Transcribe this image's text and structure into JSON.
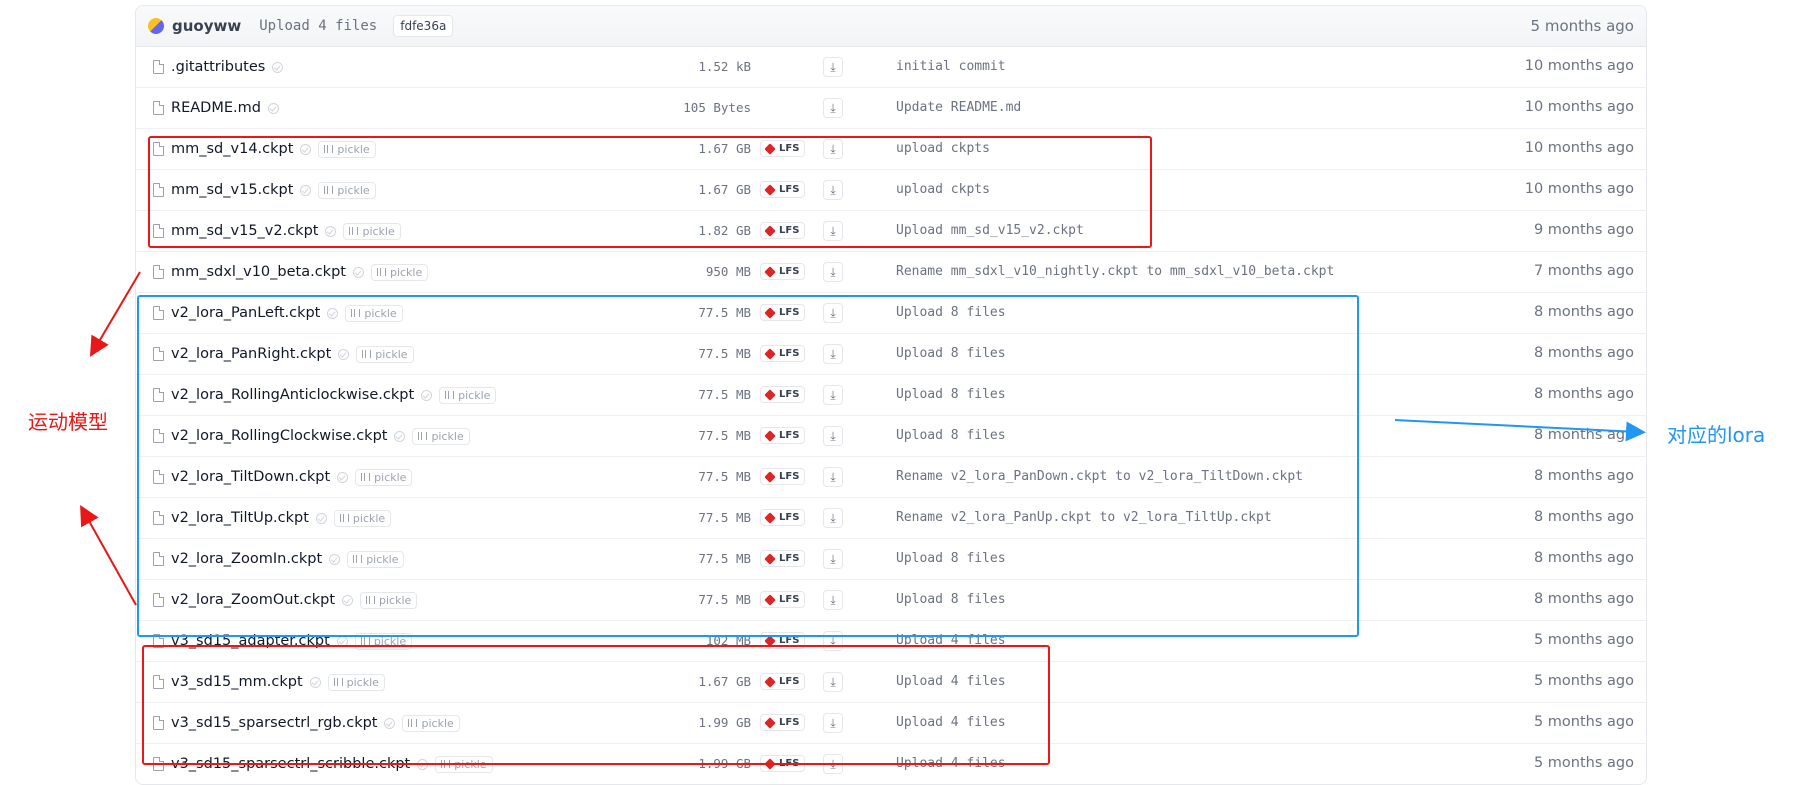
{
  "commit": {
    "author": "guoyww",
    "message": "Upload 4 files",
    "hash": "fdfe36a",
    "time": "5 months ago"
  },
  "files": [
    {
      "name": ".gitattributes",
      "size": "1.52 kB",
      "lfs": false,
      "pickle": false,
      "message": "initial commit",
      "time": "10 months ago"
    },
    {
      "name": "README.md",
      "size": "105 Bytes",
      "lfs": false,
      "pickle": false,
      "message": "Update README.md",
      "time": "10 months ago"
    },
    {
      "name": "mm_sd_v14.ckpt",
      "size": "1.67 GB",
      "lfs": true,
      "pickle": true,
      "message": "upload ckpts",
      "time": "10 months ago"
    },
    {
      "name": "mm_sd_v15.ckpt",
      "size": "1.67 GB",
      "lfs": true,
      "pickle": true,
      "message": "upload ckpts",
      "time": "10 months ago"
    },
    {
      "name": "mm_sd_v15_v2.ckpt",
      "size": "1.82 GB",
      "lfs": true,
      "pickle": true,
      "message": "Upload mm_sd_v15_v2.ckpt",
      "time": "9 months ago"
    },
    {
      "name": "mm_sdxl_v10_beta.ckpt",
      "size": "950 MB",
      "lfs": true,
      "pickle": true,
      "message": "Rename mm_sdxl_v10_nightly.ckpt to mm_sdxl_v10_beta.ckpt",
      "time": "7 months ago"
    },
    {
      "name": "v2_lora_PanLeft.ckpt",
      "size": "77.5 MB",
      "lfs": true,
      "pickle": true,
      "message": "Upload 8 files",
      "time": "8 months ago"
    },
    {
      "name": "v2_lora_PanRight.ckpt",
      "size": "77.5 MB",
      "lfs": true,
      "pickle": true,
      "message": "Upload 8 files",
      "time": "8 months ago"
    },
    {
      "name": "v2_lora_RollingAnticlockwise.ckpt",
      "size": "77.5 MB",
      "lfs": true,
      "pickle": true,
      "message": "Upload 8 files",
      "time": "8 months ago"
    },
    {
      "name": "v2_lora_RollingClockwise.ckpt",
      "size": "77.5 MB",
      "lfs": true,
      "pickle": true,
      "message": "Upload 8 files",
      "time": "8 months ago"
    },
    {
      "name": "v2_lora_TiltDown.ckpt",
      "size": "77.5 MB",
      "lfs": true,
      "pickle": true,
      "message": "Rename v2_lora_PanDown.ckpt to v2_lora_TiltDown.ckpt",
      "time": "8 months ago"
    },
    {
      "name": "v2_lora_TiltUp.ckpt",
      "size": "77.5 MB",
      "lfs": true,
      "pickle": true,
      "message": "Rename v2_lora_PanUp.ckpt to v2_lora_TiltUp.ckpt",
      "time": "8 months ago"
    },
    {
      "name": "v2_lora_ZoomIn.ckpt",
      "size": "77.5 MB",
      "lfs": true,
      "pickle": true,
      "message": "Upload 8 files",
      "time": "8 months ago"
    },
    {
      "name": "v2_lora_ZoomOut.ckpt",
      "size": "77.5 MB",
      "lfs": true,
      "pickle": true,
      "message": "Upload 8 files",
      "time": "8 months ago"
    },
    {
      "name": "v3_sd15_adapter.ckpt",
      "size": "102 MB",
      "lfs": true,
      "pickle": true,
      "message": "Upload 4 files",
      "time": "5 months ago"
    },
    {
      "name": "v3_sd15_mm.ckpt",
      "size": "1.67 GB",
      "lfs": true,
      "pickle": true,
      "message": "Upload 4 files",
      "time": "5 months ago"
    },
    {
      "name": "v3_sd15_sparsectrl_rgb.ckpt",
      "size": "1.99 GB",
      "lfs": true,
      "pickle": true,
      "message": "Upload 4 files",
      "time": "5 months ago"
    },
    {
      "name": "v3_sd15_sparsectrl_scribble.ckpt",
      "size": "1.99 GB",
      "lfs": true,
      "pickle": true,
      "message": "Upload 4 files",
      "time": "5 months ago"
    }
  ],
  "labels": {
    "pickle": "pickle",
    "lfs": "LFS",
    "download_glyph": "⤓"
  },
  "annotations": {
    "motion_models_label": "运动模型",
    "lora_label": "对应的lora",
    "colors": {
      "red": "#e81818",
      "blue": "#2196f3"
    }
  }
}
